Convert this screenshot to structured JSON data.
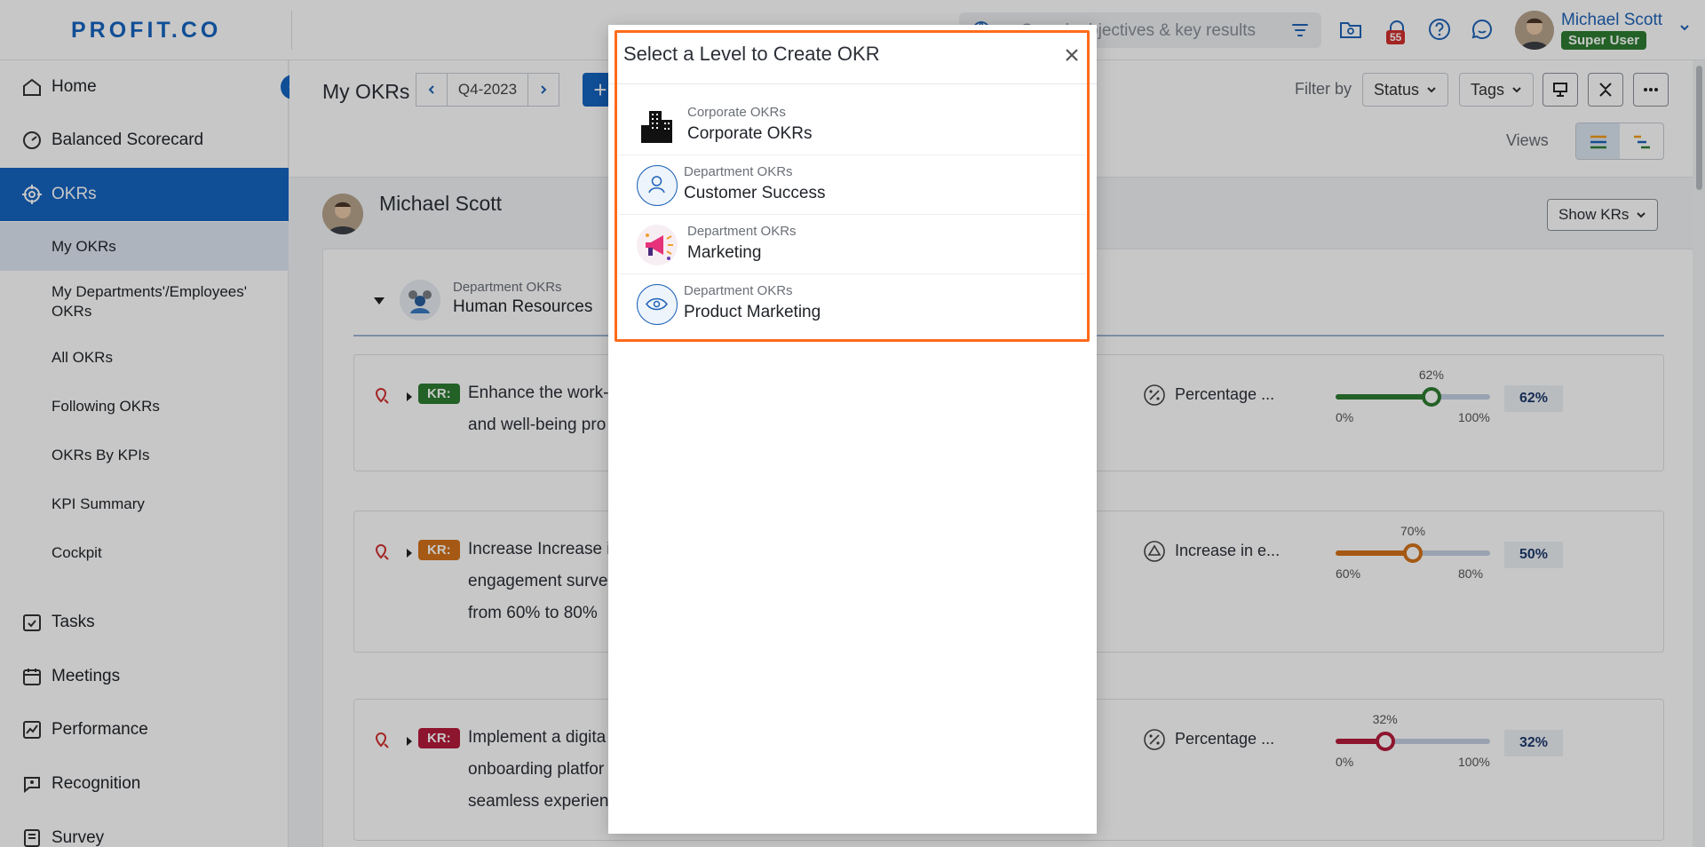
{
  "topbar": {
    "logo": "PROFIT.CO",
    "search_placeholder": "Search objectives & key results",
    "notification_count": "55",
    "user_name": "Michael Scott",
    "user_role": "Super User"
  },
  "sidebar": {
    "items": [
      {
        "label": "Home",
        "icon": "home-icon"
      },
      {
        "label": "Balanced Scorecard",
        "icon": "scorecard-icon"
      },
      {
        "label": "OKRs",
        "icon": "target-icon"
      },
      {
        "label": "Tasks",
        "icon": "tasks-icon"
      },
      {
        "label": "Meetings",
        "icon": "calendar-icon"
      },
      {
        "label": "Performance",
        "icon": "performance-icon"
      },
      {
        "label": "Recognition",
        "icon": "recognition-icon"
      },
      {
        "label": "Survey",
        "icon": "survey-icon"
      }
    ],
    "okr_subitems": [
      {
        "label": "My OKRs"
      },
      {
        "label": "My Departments'/Employees' OKRs"
      },
      {
        "label": "All OKRs"
      },
      {
        "label": "Following OKRs"
      },
      {
        "label": "OKRs By KPIs"
      },
      {
        "label": "KPI Summary"
      },
      {
        "label": "Cockpit"
      }
    ]
  },
  "header": {
    "title": "My OKRs",
    "period": "Q4-2023",
    "add_label": "+",
    "filter_label": "Filter by",
    "status_label": "Status",
    "tags_label": "Tags",
    "views_label": "Views"
  },
  "owner": {
    "name": "Michael Scott",
    "show_krs_label": "Show KRs"
  },
  "department": {
    "type": "Department OKRs",
    "name": "Human Resources"
  },
  "key_results": [
    {
      "tag": "KR:",
      "tag_color": "#2e7d32",
      "lines": [
        "Enhance the work-",
        "and well-being pro"
      ],
      "metric_icon": "percent-icon",
      "metric": "Percentage ...",
      "progress": 62,
      "progress_label": "62%",
      "min": "0%",
      "max": "100%",
      "pct": "62%",
      "color": "#2e7d32"
    },
    {
      "tag": "KR:",
      "tag_color": "#d4731b",
      "lines": [
        "Increase Increase i",
        "engagement surve",
        "from 60% to 80%"
      ],
      "metric_icon": "increase-icon",
      "metric": "Increase in e...",
      "progress": 50,
      "progress_label": "70%",
      "min": "60%",
      "max": "80%",
      "pct": "50%",
      "color": "#d4731b"
    },
    {
      "tag": "KR:",
      "tag_color": "#b71c3c",
      "lines": [
        "Implement a digita",
        "onboarding platfor",
        "seamless experien"
      ],
      "metric_icon": "percent-icon",
      "metric": "Percentage ...",
      "progress": 32,
      "progress_label": "32%",
      "min": "0%",
      "max": "100%",
      "pct": "32%",
      "color": "#b71c3c"
    }
  ],
  "modal": {
    "title": "Select a Level to Create OKR",
    "levels": [
      {
        "type": "Corporate OKRs",
        "name": "Corporate OKRs",
        "icon": "building-icon"
      },
      {
        "type": "Department OKRs",
        "name": "Customer Success",
        "icon": "person-icon"
      },
      {
        "type": "Department OKRs",
        "name": "Marketing",
        "icon": "megaphone-icon"
      },
      {
        "type": "Department OKRs",
        "name": "Product Marketing",
        "icon": "eye-icon"
      }
    ]
  }
}
